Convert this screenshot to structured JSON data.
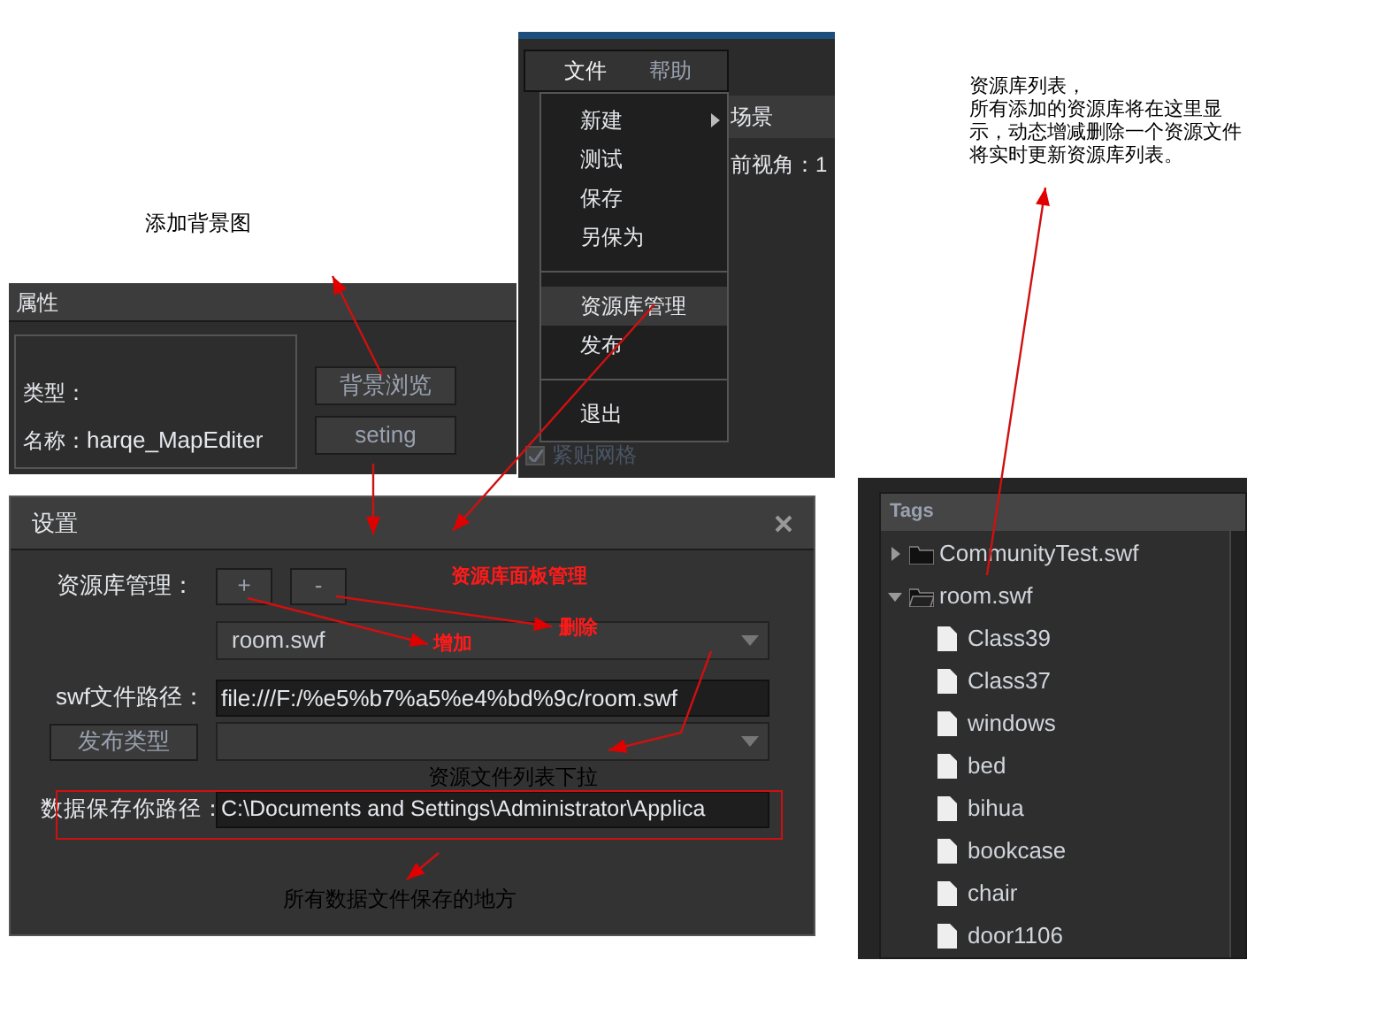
{
  "notes": {
    "background_hint": "添加背景图",
    "library_list_title": "资源库列表，",
    "library_list_text": "所有添加的资源库将在这里显示，动态增减删除一个资源文件将实时更新资源库列表。",
    "library_panel_hint": "资源库面板管理",
    "add_hint": "增加",
    "delete_hint": "删除",
    "dropdown_hint": "资源文件列表下拉",
    "data_path_hint": "所有数据文件保存的地方"
  },
  "properties_panel": {
    "title": "属性",
    "type_label": "类型：",
    "name_label": "名称：",
    "name_value": "harqe_MapEditer",
    "buttons": [
      "背景浏览",
      "seting"
    ]
  },
  "editor_window": {
    "menubar": [
      {
        "label": "文件",
        "selected": true
      },
      {
        "label": "帮助",
        "selected": false
      }
    ],
    "background_texts": [
      "场景",
      "前视角：1"
    ],
    "snap_checkbox": {
      "label": "紧贴网格",
      "checked": true,
      "disabled": true
    },
    "menu": [
      {
        "kind": "item",
        "label": "新建",
        "submenu": true,
        "selected": false
      },
      {
        "kind": "item",
        "label": "测试",
        "submenu": false,
        "selected": false
      },
      {
        "kind": "item",
        "label": "保存",
        "submenu": false,
        "selected": false
      },
      {
        "kind": "item",
        "label": "另保为",
        "submenu": false,
        "selected": false
      },
      {
        "kind": "separator"
      },
      {
        "kind": "item",
        "label": "资源库管理",
        "submenu": false,
        "selected": true
      },
      {
        "kind": "item",
        "label": "发布",
        "submenu": false,
        "selected": false
      },
      {
        "kind": "separator"
      },
      {
        "kind": "item",
        "label": "退出",
        "submenu": false,
        "selected": false
      }
    ]
  },
  "settings_dialog": {
    "title": "设置",
    "library_label": "资源库管理：",
    "add_button": "+",
    "remove_button": "-",
    "library_select": "room.swf",
    "swf_path_label": "swf文件路径：",
    "swf_path": "file:///F:/%e5%b7%a5%e4%bd%9c/room.swf",
    "publish_type_button": "发布类型",
    "data_path_label": "数据保存你路径：",
    "data_path": "C:\\Documents and Settings\\Administrator\\Applica"
  },
  "tags_panel": {
    "title": "Tags",
    "tree": [
      {
        "label": "CommunityTest.swf",
        "expanded": false
      },
      {
        "label": "room.swf",
        "expanded": true,
        "children": [
          {
            "label": "Class39"
          },
          {
            "label": "Class37"
          },
          {
            "label": "windows"
          },
          {
            "label": "bed"
          },
          {
            "label": "bihua"
          },
          {
            "label": "bookcase"
          },
          {
            "label": "chair"
          },
          {
            "label": "door1106"
          }
        ]
      }
    ]
  }
}
